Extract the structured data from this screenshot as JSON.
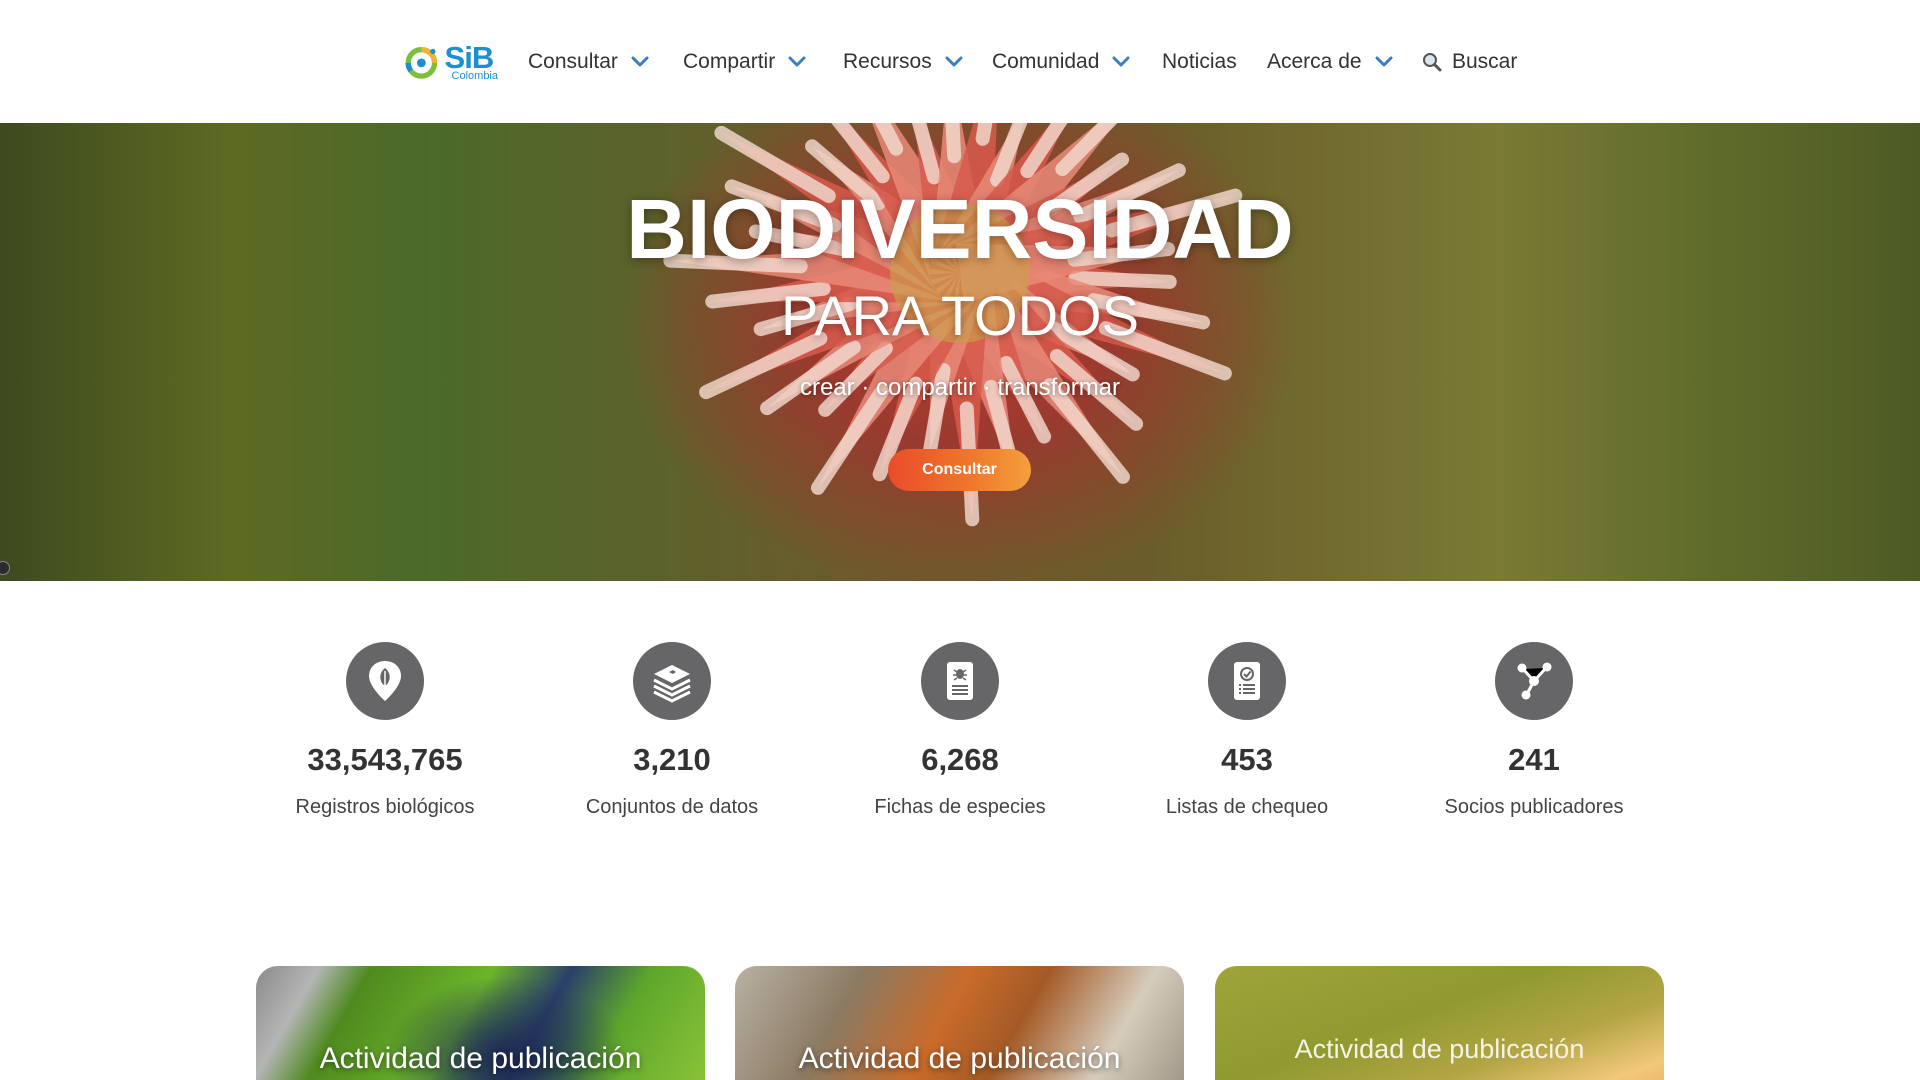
{
  "header": {
    "logo": {
      "text": "SiB",
      "subtext": "Colombia"
    },
    "nav": [
      {
        "label": "Consultar",
        "has_dropdown": true
      },
      {
        "label": "Compartir",
        "has_dropdown": true
      },
      {
        "label": "Recursos",
        "has_dropdown": true
      },
      {
        "label": "Comunidad",
        "has_dropdown": true
      },
      {
        "label": "Noticias",
        "has_dropdown": false
      },
      {
        "label": "Acerca de",
        "has_dropdown": true
      }
    ],
    "search_label": "Buscar"
  },
  "hero": {
    "title": "BIODIVERSIDAD",
    "subtitle": "PARA TODOS",
    "tagline": "crear · compartir · transformar",
    "button_label": "Consultar"
  },
  "stats": [
    {
      "icon": "map-pin-leaf-icon",
      "value": "33,543,765",
      "label": "Registros biológicos"
    },
    {
      "icon": "layers-bird-icon",
      "value": "3,210",
      "label": "Conjuntos de datos"
    },
    {
      "icon": "species-sheet-bug-icon",
      "value": "6,268",
      "label": "Fichas de especies"
    },
    {
      "icon": "checklist-icon",
      "value": "453",
      "label": "Listas de chequeo"
    },
    {
      "icon": "network-nodes-icon",
      "value": "241",
      "label": "Socios publicadores"
    }
  ],
  "cards": [
    {
      "title": "Actividad de publicación"
    },
    {
      "title": "Actividad de publicación"
    },
    {
      "title": "Actividad de publicación"
    }
  ],
  "colors": {
    "link_blue": "#1c8fd0",
    "chevron_blue": "#3a7fc1",
    "button_orange": "#ea4b2a",
    "icon_grey": "#666669",
    "text_dark": "#333333"
  }
}
